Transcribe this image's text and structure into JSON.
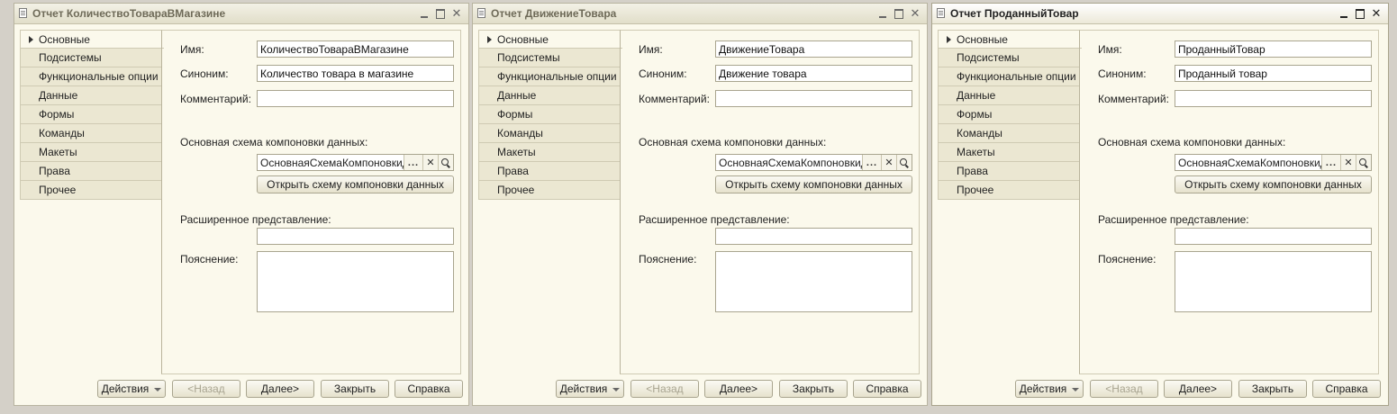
{
  "windows": [
    {
      "title": "Отчет КоличествоТовараВМагазине",
      "active": false,
      "name_value": "КоличествоТовараВМагазине",
      "synonym_value": "Количество товара в магазине",
      "comment_value": "",
      "schema_value": "ОсновнаяСхемаКомпоновкиДанн",
      "extended_value": "",
      "explanation_value": ""
    },
    {
      "title": "Отчет ДвижениеТовара",
      "active": false,
      "name_value": "ДвижениеТовара",
      "synonym_value": "Движение товара",
      "comment_value": "",
      "schema_value": "ОсновнаяСхемаКомпоновкиДанн",
      "extended_value": "",
      "explanation_value": ""
    },
    {
      "title": "Отчет ПроданныйТовар",
      "active": true,
      "name_value": "ПроданныйТовар",
      "synonym_value": "Проданный товар",
      "comment_value": "",
      "schema_value": "ОсновнаяСхемаКомпоновкиДанн",
      "extended_value": "",
      "explanation_value": ""
    }
  ],
  "nav_items": [
    "Основные",
    "Подсистемы",
    "Функциональные опции",
    "Данные",
    "Формы",
    "Команды",
    "Макеты",
    "Права",
    "Прочее"
  ],
  "labels": {
    "name": "Имя:",
    "synonym": "Синоним:",
    "comment": "Комментарий:",
    "schema": "Основная схема компоновки данных:",
    "open_schema": "Открыть схему компоновки данных",
    "extended": "Расширенное представление:",
    "explanation": "Пояснение:"
  },
  "buttons": {
    "actions": "Действия",
    "back": "<Назад",
    "next": "Далее>",
    "close": "Закрыть",
    "help": "Справка"
  },
  "icons": {
    "window": "report-icon",
    "minimize": "minimize-icon",
    "maximize": "maximize-icon",
    "close": "close-icon",
    "clear": "clear-icon",
    "search": "search-icon"
  },
  "colors": {
    "desktop": "#d4d0c8",
    "window_bg": "#fbf9ec",
    "nav_bg": "#ebe7d2"
  }
}
